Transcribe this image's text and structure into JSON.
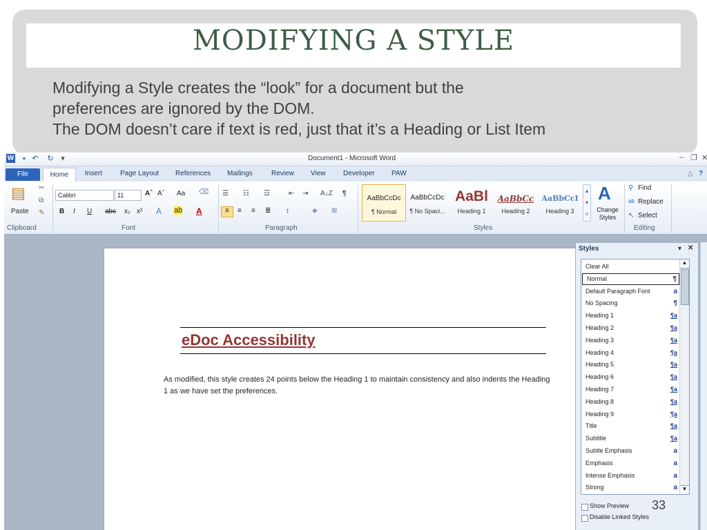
{
  "slide": {
    "title": "MODIFYING A STYLE",
    "lines": [
      "Modifying a Style creates the “look” for a document but the",
      "preferences are ignored by the DOM.",
      "The DOM doesn’t care if text is red, just that it’s a Heading or List Item"
    ],
    "page_number": "33"
  },
  "window": {
    "title": "Document1 - Microsoft Word",
    "qat": {
      "save_icon": "save-icon",
      "undo_icon": "undo-icon",
      "redo_icon": "redo-icon"
    }
  },
  "tabs": [
    {
      "label": "File"
    },
    {
      "label": "Home"
    },
    {
      "label": "Insert"
    },
    {
      "label": "Page Layout"
    },
    {
      "label": "References"
    },
    {
      "label": "Mailings"
    },
    {
      "label": "Review"
    },
    {
      "label": "View"
    },
    {
      "label": "Developer"
    },
    {
      "label": "PAW"
    }
  ],
  "ribbon": {
    "clipboard": {
      "label": "Clipboard",
      "paste": "Paste"
    },
    "font": {
      "label": "Font",
      "name": "Calibri",
      "size": "11",
      "bold": "B",
      "italic": "I",
      "underline": "U",
      "strike": "abc",
      "subscript": "x₂",
      "superscript": "x²",
      "grow": "Aˆ",
      "shrink": "Aˇ",
      "case": "Aa"
    },
    "paragraph": {
      "label": "Paragraph",
      "sort": "A↓Z",
      "pilcrow": "¶"
    },
    "styles": {
      "label": "Styles",
      "tiles": [
        {
          "preview": "AaBbCcDc",
          "name": "¶ Normal"
        },
        {
          "preview": "AaBbCcDc",
          "name": "¶ No Spaci..."
        },
        {
          "preview": "AaBl",
          "name": "Heading 1"
        },
        {
          "preview": "AaBbCc",
          "name": "Heading 2"
        },
        {
          "preview": "AaBbCcI",
          "name": "Heading 3"
        }
      ],
      "change_styles": "Change Styles"
    },
    "editing": {
      "label": "Editing",
      "find": "Find",
      "replace": "Replace",
      "select": "Select"
    }
  },
  "document": {
    "heading": "eDoc Accessibility",
    "body": "As modified, this style creates 24 points below the Heading 1 to maintain consistency and also indents the Heading 1 as we have set the preferences."
  },
  "styles_pane": {
    "title": "Styles",
    "selected": "Normal",
    "items": [
      {
        "name": "Clear All",
        "glyph": ""
      },
      {
        "name": "Normal",
        "glyph": "¶"
      },
      {
        "name": "Default Paragraph Font",
        "glyph": "a"
      },
      {
        "name": "No Spacing",
        "glyph": "¶"
      },
      {
        "name": "Heading 1",
        "glyph": "¶a"
      },
      {
        "name": "Heading 2",
        "glyph": "¶a"
      },
      {
        "name": "Heading 3",
        "glyph": "¶a"
      },
      {
        "name": "Heading 4",
        "glyph": "¶a"
      },
      {
        "name": "Heading 5",
        "glyph": "¶a"
      },
      {
        "name": "Heading 6",
        "glyph": "¶a"
      },
      {
        "name": "Heading 7",
        "glyph": "¶a"
      },
      {
        "name": "Heading 8",
        "glyph": "¶a"
      },
      {
        "name": "Heading 9",
        "glyph": "¶a"
      },
      {
        "name": "Title",
        "glyph": "¶a"
      },
      {
        "name": "Subtitle",
        "glyph": "¶a"
      },
      {
        "name": "Subtle Emphasis",
        "glyph": "a"
      },
      {
        "name": "Emphasis",
        "glyph": "a"
      },
      {
        "name": "Intense Emphasis",
        "glyph": "a"
      },
      {
        "name": "Strong",
        "glyph": "a"
      }
    ],
    "show_preview": "Show Preview",
    "disable_linked": "Disable Linked Styles"
  },
  "colors": {
    "title": "#3e5c46",
    "heading_red": "#943634",
    "file_tab": "#2c64b8",
    "workspace": "#abb6c4"
  }
}
